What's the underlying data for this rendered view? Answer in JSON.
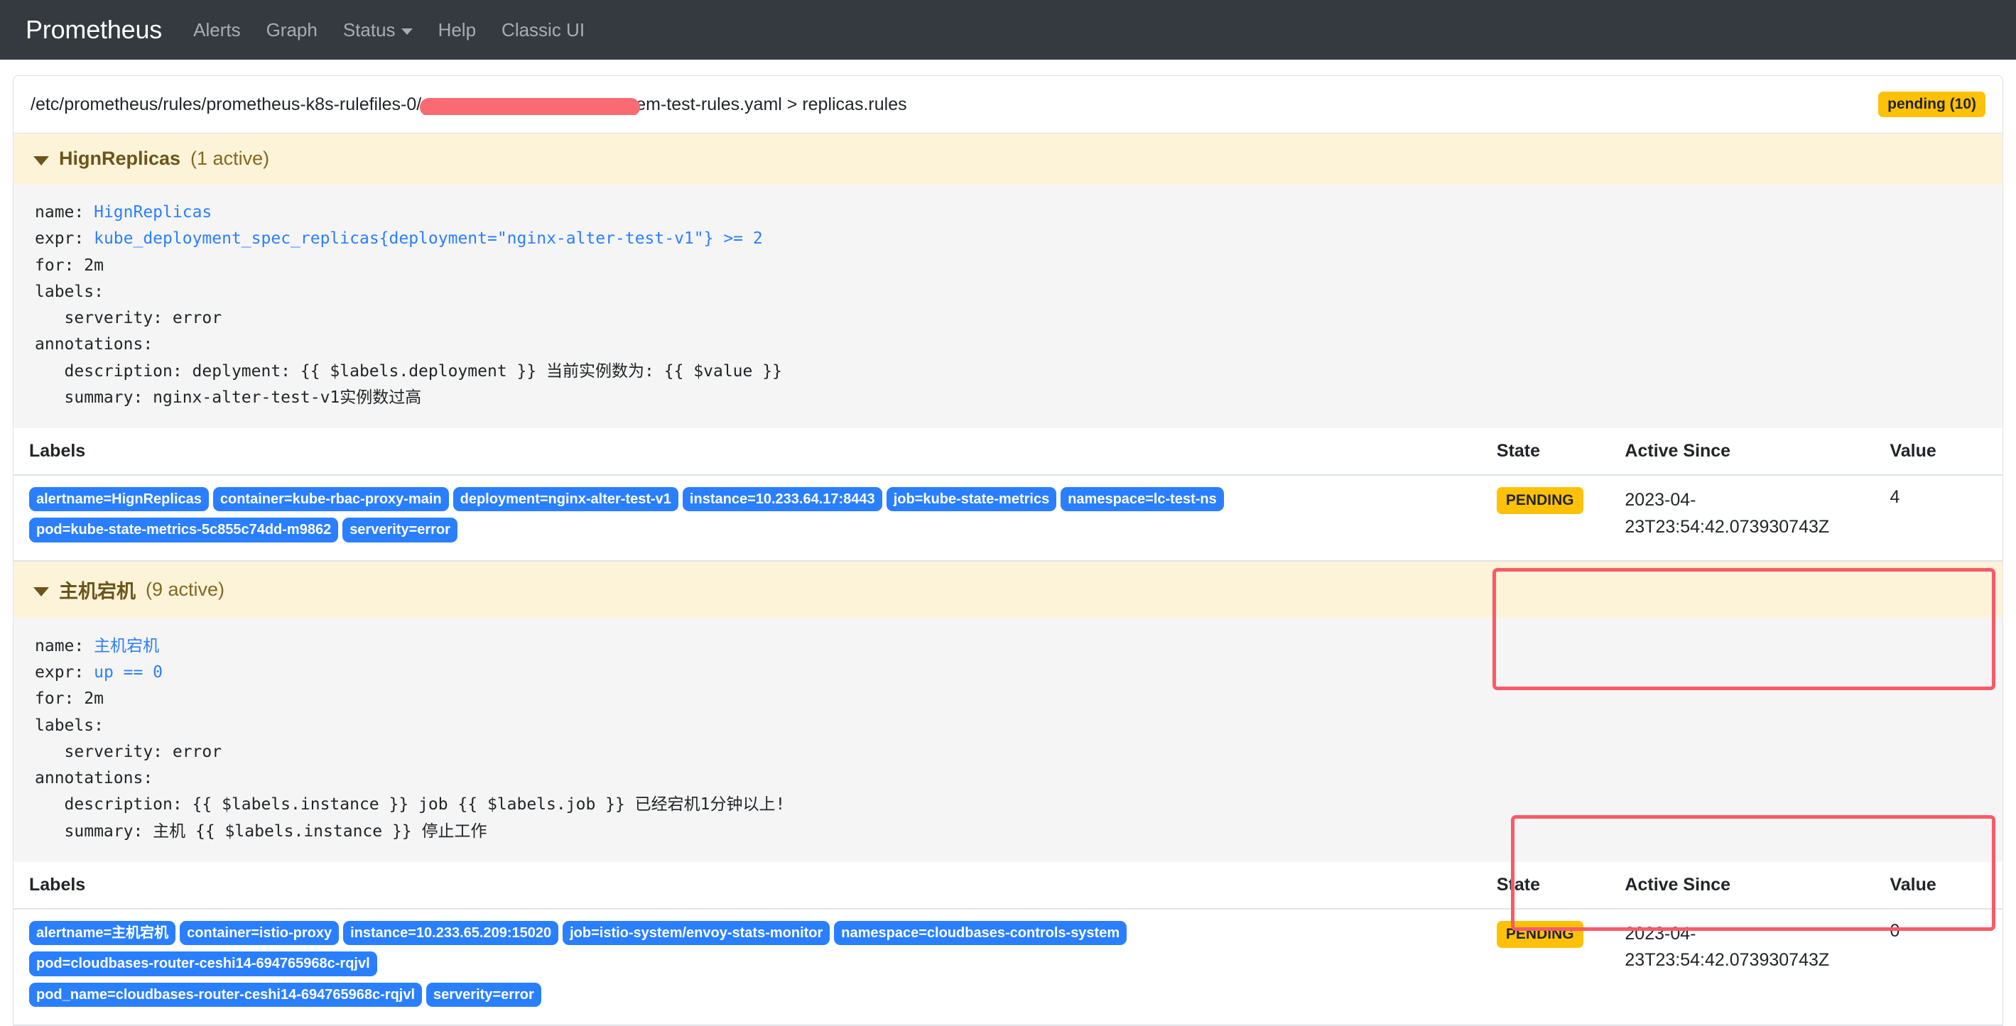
{
  "navbar": {
    "brand": "Prometheus",
    "links": [
      {
        "label": "Alerts",
        "icon": ""
      },
      {
        "label": "Graph",
        "icon": ""
      },
      {
        "label": "Status",
        "icon": "chevron-down-icon"
      },
      {
        "label": "Help",
        "icon": ""
      },
      {
        "label": "Classic UI",
        "icon": ""
      }
    ]
  },
  "file": {
    "path_prefix": "/etc/prometheus/rules/prometheus-k8s-rulefiles-0/",
    "path_suffix": "em-test-rules.yaml > replicas.rules",
    "status_badge": "pending (10)",
    "status_badge_color": "#ffc107"
  },
  "table_headers": {
    "labels": "Labels",
    "state": "State",
    "active_since": "Active Since",
    "value": "Value"
  },
  "groups": [
    {
      "name": "HignReplicas",
      "count": "(1 active)",
      "rule": {
        "name_key": "name: ",
        "name_val": "HignReplicas",
        "expr_key": "expr: ",
        "expr_val": "kube_deployment_spec_replicas{deployment=\"nginx-alter-test-v1\"} >= 2",
        "for_line": "for: 2m",
        "labels_line": "labels:",
        "severity_line": "   serverity: error",
        "annotations_line": "annotations:",
        "description_line": "   description: deplyment: {{ $labels.deployment }} 当前实例数为: {{ $value }}",
        "summary_line": "   summary: nginx-alter-test-v1实例数过高"
      },
      "alerts": [
        {
          "labels": [
            "alertname=HignReplicas",
            "container=kube-rbac-proxy-main",
            "deployment=nginx-alter-test-v1",
            "instance=10.233.64.17:8443",
            "job=kube-state-metrics",
            "namespace=lc-test-ns",
            "pod=kube-state-metrics-5c855c74dd-m9862",
            "serverity=error"
          ],
          "state": "PENDING",
          "active_since": "2023-04-23T23:54:42.073930743Z",
          "value": "4"
        }
      ]
    },
    {
      "name": "主机宕机",
      "count": "(9 active)",
      "rule": {
        "name_key": "name: ",
        "name_val": "主机宕机",
        "expr_key": "expr: ",
        "expr_val": "up == 0",
        "for_line": "for: 2m",
        "labels_line": "labels:",
        "severity_line": "   serverity: error",
        "annotations_line": "annotations:",
        "description_line": "   description: {{ $labels.instance }} job {{ $labels.job }} 已经宕机1分钟以上!",
        "summary_line": "   summary: 主机 {{ $labels.instance }} 停止工作"
      },
      "alerts": [
        {
          "labels": [
            "alertname=主机宕机",
            "container=istio-proxy",
            "instance=10.233.65.209:15020",
            "job=istio-system/envoy-stats-monitor",
            "namespace=cloudbases-controls-system",
            "pod=cloudbases-router-ceshi14-694765968c-rqjvl",
            "pod_name=cloudbases-router-ceshi14-694765968c-rqjvl",
            "serverity=error"
          ],
          "state": "PENDING",
          "active_since": "2023-04-23T23:54:42.073930743Z",
          "value": "0"
        }
      ]
    }
  ]
}
